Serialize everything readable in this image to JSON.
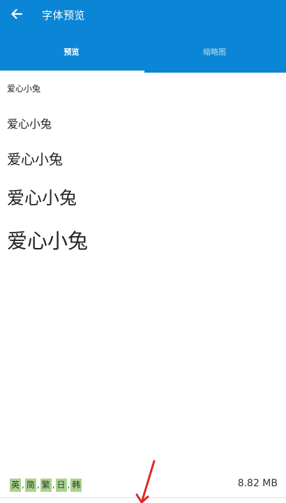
{
  "header": {
    "title": "字体预览",
    "back_icon": "arrow-left-icon"
  },
  "tabs": [
    {
      "label": "预览",
      "active": true
    },
    {
      "label": "缩略图",
      "active": false
    }
  ],
  "preview": {
    "samples": [
      "爱心小兔",
      "爱心小兔",
      "爱心小兔",
      "爱心小兔",
      "爱心小兔"
    ]
  },
  "footer": {
    "languages": [
      "英",
      "简",
      "繁",
      "日",
      "韩"
    ],
    "separator": ",",
    "file_size": "8.82 MB"
  },
  "colors": {
    "appbar": "#0b86d6",
    "lang_tag_bg": "#a9d38e",
    "annotation_arrow": "#e0231f"
  }
}
